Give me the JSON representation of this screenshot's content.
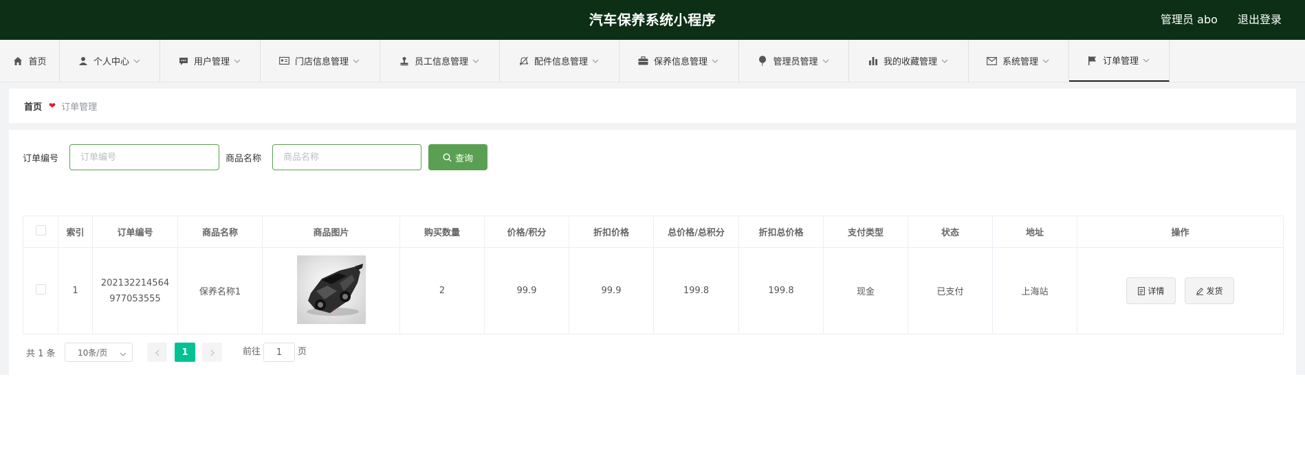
{
  "app": {
    "title": "汽车保养系统小程序",
    "user_label": "管理员 abo",
    "logout_label": "退出登录"
  },
  "nav": {
    "items": [
      {
        "label": "首页",
        "icon": "home-icon",
        "has_dropdown": false
      },
      {
        "label": "个人中心",
        "icon": "user-icon",
        "has_dropdown": true
      },
      {
        "label": "用户管理",
        "icon": "chat-icon",
        "has_dropdown": true
      },
      {
        "label": "门店信息管理",
        "icon": "id-card-icon",
        "has_dropdown": true
      },
      {
        "label": "员工信息管理",
        "icon": "stamp-icon",
        "has_dropdown": true
      },
      {
        "label": "配件信息管理",
        "icon": "bell-off-icon",
        "has_dropdown": true
      },
      {
        "label": "保养信息管理",
        "icon": "briefcase-icon",
        "has_dropdown": true
      },
      {
        "label": "管理员管理",
        "icon": "balloon-icon",
        "has_dropdown": true
      },
      {
        "label": "我的收藏管理",
        "icon": "bar-chart-icon",
        "has_dropdown": true
      },
      {
        "label": "系统管理",
        "icon": "mail-icon",
        "has_dropdown": true
      },
      {
        "label": "订单管理",
        "icon": "flag-icon",
        "has_dropdown": true,
        "active": true
      }
    ]
  },
  "breadcrumb": {
    "home": "首页",
    "current": "订单管理"
  },
  "search": {
    "order_no_label": "订单编号",
    "order_no_placeholder": "订单编号",
    "order_no_value": "",
    "product_label": "商品名称",
    "product_placeholder": "商品名称",
    "product_value": "",
    "query_label": "查询"
  },
  "table": {
    "columns": [
      "索引",
      "订单编号",
      "商品名称",
      "商品图片",
      "购买数量",
      "价格/积分",
      "折扣价格",
      "总价格/总积分",
      "折扣总价格",
      "支付类型",
      "状态",
      "地址",
      "操作"
    ],
    "rows": [
      {
        "index": "1",
        "order_no_line1": "202132214564",
        "order_no_line2": "977053555",
        "product_name": "保养名称1",
        "quantity": "2",
        "price": "99.9",
        "discount_price": "99.9",
        "total_price": "199.8",
        "discount_total": "199.8",
        "pay_type": "现金",
        "status": "已支付",
        "address": "上海站",
        "detail_label": "详情",
        "ship_label": "发货"
      }
    ]
  },
  "pagination": {
    "total_text": "共 1 条",
    "page_size": "10条/页",
    "current_page": "1",
    "goto_label": "前往",
    "goto_value": "1",
    "goto_suffix": "页"
  },
  "colors": {
    "header_bg": "#0c2f16",
    "primary_green": "#5aa052",
    "pager_active": "#00c292",
    "breadcrumb_heart": "#e0192c"
  }
}
